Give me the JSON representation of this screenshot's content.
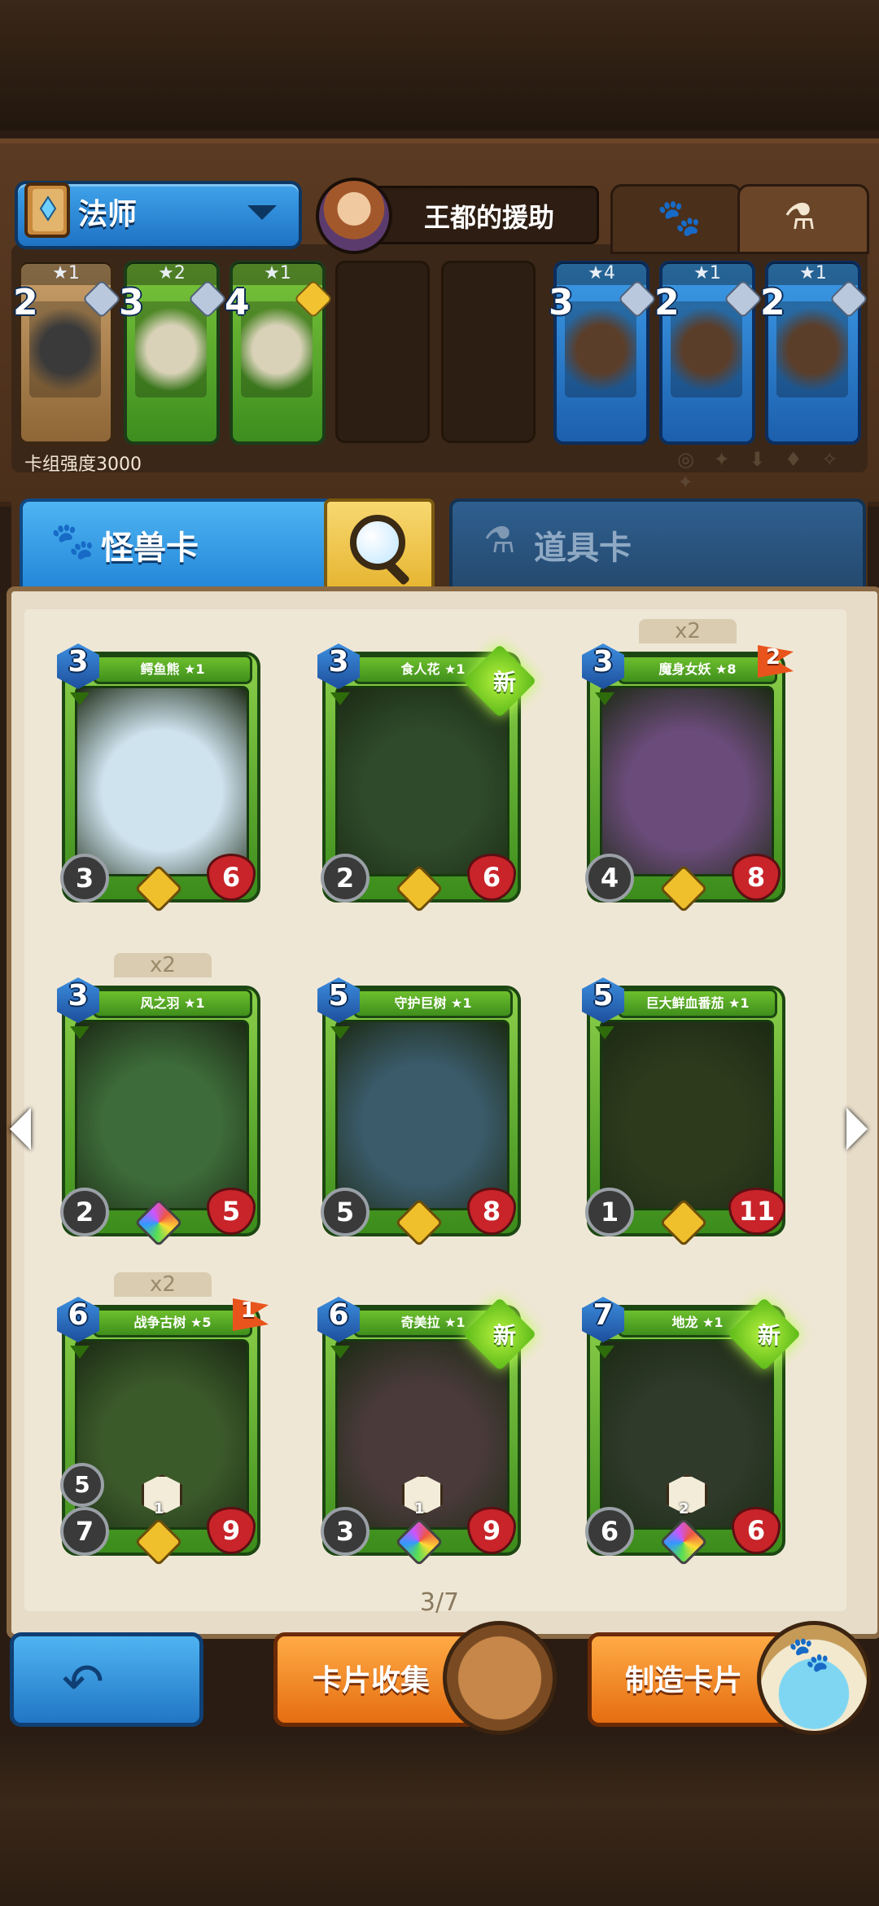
{
  "class_select": {
    "label": "法师"
  },
  "hero": {
    "name": "王都的援助"
  },
  "filter_tabs": [
    {
      "icon": "paw-icon"
    },
    {
      "icon": "flask-icon"
    }
  ],
  "deck": {
    "power_label": "卡组强度3000",
    "slots": [
      {
        "stars": "★1",
        "cost": "2",
        "rarity": "silver",
        "color": "tan"
      },
      {
        "stars": "★2",
        "cost": "3",
        "rarity": "silver",
        "color": "green"
      },
      {
        "stars": "★1",
        "cost": "4",
        "rarity": "gold",
        "color": "green"
      },
      {
        "empty": true
      },
      {
        "empty": true
      },
      {
        "stars": "★4",
        "cost": "3",
        "rarity": "silver",
        "color": "blue"
      },
      {
        "stars": "★1",
        "cost": "2",
        "rarity": "silver",
        "color": "blue"
      },
      {
        "stars": "★1",
        "cost": "2",
        "rarity": "silver",
        "color": "blue"
      }
    ],
    "element_icons": "◎ ✦ ⬇ ♦ ✧ ✦"
  },
  "category_tabs": {
    "monster": "怪兽卡",
    "item": "道具卡"
  },
  "cards": [
    {
      "name": "鳄鱼熊 ★1",
      "cost": "3",
      "atk": "3",
      "hp": "6",
      "gem": "gold"
    },
    {
      "name": "食人花 ★1",
      "cost": "3",
      "atk": "2",
      "hp": "6",
      "gem": "gold",
      "new": "新"
    },
    {
      "name": "魔身女妖 ★8",
      "cost": "3",
      "atk": "4",
      "hp": "8",
      "gem": "gold",
      "dup": "x2",
      "flag": "2"
    },
    {
      "name": "风之羽 ★1",
      "cost": "3",
      "atk": "2",
      "hp": "5",
      "gem": "rainbow",
      "dup": "x2"
    },
    {
      "name": "守护巨树 ★1",
      "cost": "5",
      "atk": "5",
      "hp": "8",
      "gem": "gold"
    },
    {
      "name": "巨大鲜血番茄 ★1",
      "cost": "5",
      "atk": "1",
      "hp": "11",
      "gem": "gold"
    },
    {
      "name": "战争古树 ★5",
      "cost": "6",
      "atk": "7",
      "hp": "9",
      "range": "5",
      "gem": "gold",
      "dup": "x2",
      "flag": "1",
      "skill_num": "1"
    },
    {
      "name": "奇美拉 ★1",
      "cost": "6",
      "atk": "3",
      "hp": "9",
      "gem": "rainbow",
      "new": "新",
      "skill_num": "1"
    },
    {
      "name": "地龙 ★1",
      "cost": "7",
      "atk": "6",
      "hp": "6",
      "gem": "rainbow",
      "new": "新",
      "skill_num": "2"
    }
  ],
  "pagination": {
    "label": "3/7"
  },
  "buttons": {
    "back": "back-arrow-icon",
    "collect": "卡片收集",
    "craft": "制造卡片"
  },
  "colors": {
    "accent_blue": "#2386d8",
    "accent_orange": "#e56e12",
    "card_green": "#3b8c1c"
  }
}
